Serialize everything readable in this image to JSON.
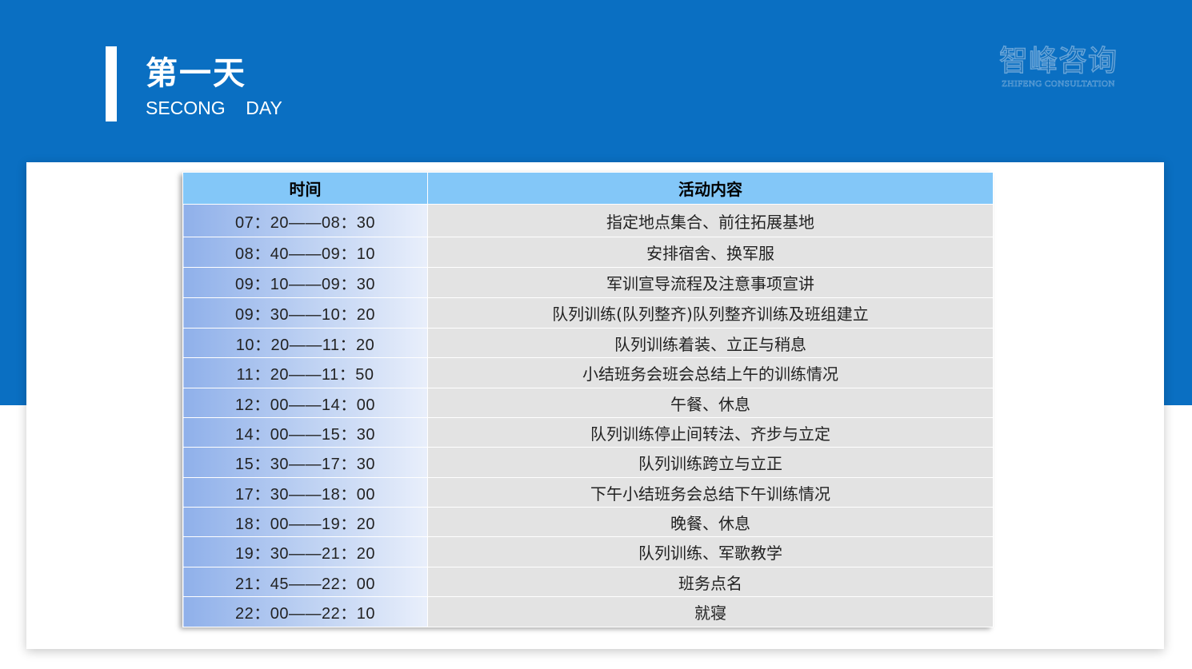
{
  "slide": {
    "title": "第一天",
    "subtitle": "SECONG    DAY",
    "logo": {
      "chinese": "智峰咨询",
      "english": "ZHIFENG CONSULTATION"
    }
  },
  "schedule": {
    "headers": {
      "time": "时间",
      "activity": "活动内容"
    },
    "rows": [
      {
        "time": "07：20——08：30",
        "activity": "指定地点集合、前往拓展基地"
      },
      {
        "time": "08：40——09：10",
        "activity": "安排宿舍、换军服"
      },
      {
        "time": "09：10——09：30",
        "activity": "军训宣导流程及注意事项宣讲"
      },
      {
        "time": "09：30——10：20",
        "activity": "队列训练(队列整齐)队列整齐训练及班组建立"
      },
      {
        "time": "10：20——11：20",
        "activity": "队列训练着装、立正与稍息"
      },
      {
        "time": "11：20——11：50",
        "activity": "小结班务会班会总结上午的训练情况"
      },
      {
        "time": "12：00——14：00",
        "activity": "午餐、休息"
      },
      {
        "time": "14：00——15：30",
        "activity": "队列训练停止间转法、齐步与立定"
      },
      {
        "time": "15：30——17：30",
        "activity": "队列训练跨立与立正"
      },
      {
        "time": "17：30——18：00",
        "activity": "下午小结班务会总结下午训练情况"
      },
      {
        "time": "18：00——19：20",
        "activity": "晚餐、休息"
      },
      {
        "time": "19：30——21：20",
        "activity": "队列训练、军歌教学"
      },
      {
        "time": "21：45——22：00",
        "activity": "班务点名"
      },
      {
        "time": "22：00——22：10",
        "activity": "就寝"
      }
    ]
  },
  "colors": {
    "band": "#0a6fc2",
    "header": "#83c7f8",
    "time_gradient_start": "#8fb0ea",
    "activity_bg": "#e3e3e3"
  }
}
